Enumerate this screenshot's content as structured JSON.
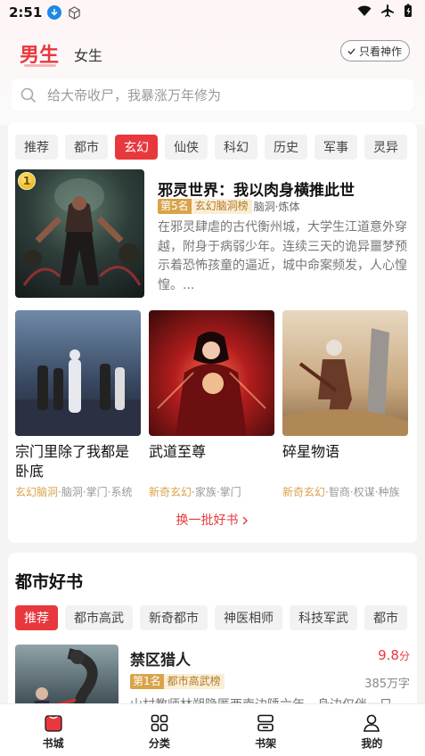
{
  "status": {
    "time": "2:51"
  },
  "header": {
    "tab_male": "男生",
    "tab_female": "女生",
    "only_btn": "只看神作"
  },
  "search": {
    "placeholder": "给大帝收尸，我暴涨万年修为"
  },
  "section1": {
    "chips": [
      {
        "label": "推荐",
        "active": false
      },
      {
        "label": "都市",
        "active": false
      },
      {
        "label": "玄幻",
        "active": true
      },
      {
        "label": "仙侠",
        "active": false
      },
      {
        "label": "科幻",
        "active": false
      },
      {
        "label": "历史",
        "active": false
      },
      {
        "label": "军事",
        "active": false
      },
      {
        "label": "灵异",
        "active": false
      }
    ],
    "featured": {
      "rank_badge": "1",
      "title": "邪灵世界：我以肉身横推此世",
      "rank": "第5名",
      "rank_list": "玄幻脑洞榜",
      "tags": "脑洞·炼体",
      "desc": "在邪灵肆虐的古代衡州城，大学生江道意外穿越，附身于病弱少年。连续三天的诡异噩梦预示着恐怖孩童的逼近，城中命案频发，人心惶惶。..."
    },
    "grid": [
      {
        "title": "宗门里除了我都是卧底",
        "tag_hl": "玄幻脑洞",
        "tags_rest": "·脑洞·掌门·系统"
      },
      {
        "title": "武道至尊",
        "tag_hl": "新奇玄幻",
        "tags_rest": "·家族·掌门"
      },
      {
        "title": "碎星物语",
        "tag_hl": "新奇玄幻",
        "tags_rest": "·智商·权谋·种族"
      }
    ],
    "refresh": "换一批好书"
  },
  "section2": {
    "title": "都市好书",
    "chips": [
      {
        "label": "推荐",
        "active": true
      },
      {
        "label": "都市高武",
        "active": false
      },
      {
        "label": "新奇都市",
        "active": false
      },
      {
        "label": "神医相师",
        "active": false
      },
      {
        "label": "科技军武",
        "active": false
      },
      {
        "label": "都市",
        "active": false
      }
    ],
    "book": {
      "title": "禁区猎人",
      "score": "9.8",
      "score_unit": "分",
      "rank": "第1名",
      "rank_list": "都市高武榜",
      "words": "385万字",
      "desc": "山村教师林朔隐匿西南边陲六年，身边仅伴一只"
    }
  },
  "bottom_nav": [
    {
      "label": "书城",
      "icon": "bookstore-icon",
      "active": true
    },
    {
      "label": "分类",
      "icon": "category-icon",
      "active": false
    },
    {
      "label": "书架",
      "icon": "bookshelf-icon",
      "active": false
    },
    {
      "label": "我的",
      "icon": "profile-icon",
      "active": false
    }
  ],
  "colors": {
    "accent": "#e8383d",
    "gold": "#d9a34a"
  }
}
